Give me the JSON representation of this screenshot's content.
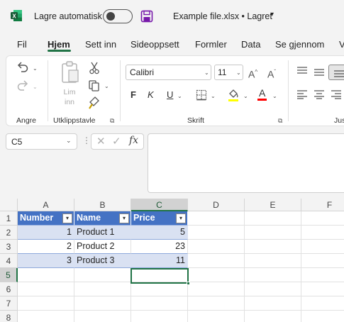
{
  "titlebar": {
    "autosave_label": "Lagre automatisk",
    "filename": "Example file.xlsx • Lagret",
    "caret": "▾"
  },
  "tabs": [
    {
      "label": "Fil",
      "active": false
    },
    {
      "label": "Hjem",
      "active": true
    },
    {
      "label": "Sett inn",
      "active": false
    },
    {
      "label": "Sideoppsett",
      "active": false
    },
    {
      "label": "Formler",
      "active": false
    },
    {
      "label": "Data",
      "active": false
    },
    {
      "label": "Se gjennom",
      "active": false
    },
    {
      "label": "V",
      "active": false
    }
  ],
  "ribbon": {
    "groups": {
      "undo": "Angre",
      "clipboard": "Utklippstavle",
      "font": "Skrift",
      "align": "Jus"
    },
    "paste_label": "Lim inn",
    "font_name": "Calibri",
    "font_size": "11",
    "bold": "F",
    "italic": "K",
    "underline": "U",
    "grow_font": "A^",
    "shrink_font": "Aˇ",
    "font_color_letter": "A"
  },
  "formula_bar": {
    "name_box": "C5",
    "fx": "fx",
    "formula": ""
  },
  "grid": {
    "columns": [
      "A",
      "B",
      "C",
      "D",
      "E",
      "F"
    ],
    "rows": [
      "1",
      "2",
      "3",
      "4",
      "5",
      "6",
      "7",
      "8"
    ],
    "selected_column": "C",
    "selected_row": "5",
    "table_headers": [
      "Number",
      "Name",
      "Price"
    ],
    "table_rows": [
      {
        "number": "1",
        "name": "Product 1",
        "price": "5"
      },
      {
        "number": "2",
        "name": "Product 2",
        "price": "23"
      },
      {
        "number": "3",
        "name": "Product 3",
        "price": "11"
      }
    ]
  },
  "colors": {
    "accent": "#217346",
    "table_header": "#4472c4",
    "table_band": "#d9e1f2",
    "save_icon": "#7719aa",
    "highlight_yellow": "#ffff00",
    "font_red": "#ff0000"
  }
}
